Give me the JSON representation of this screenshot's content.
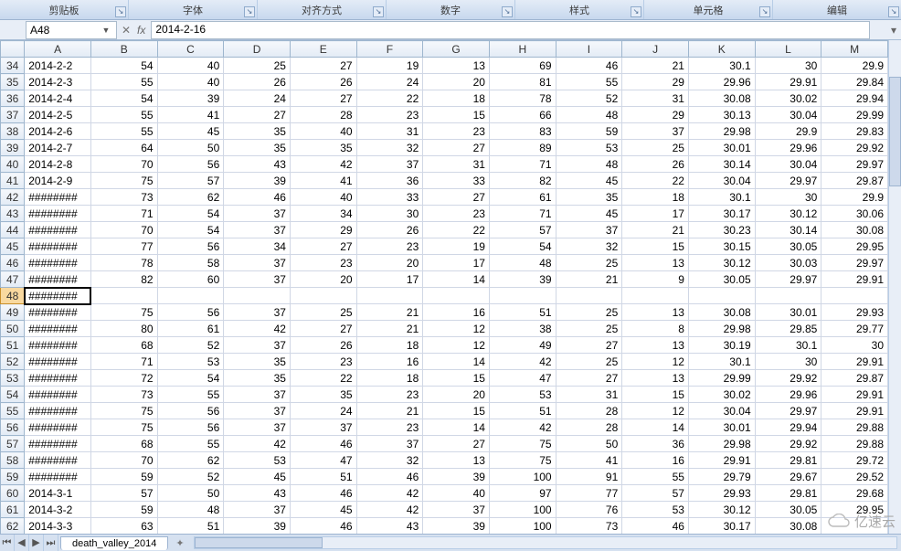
{
  "ribbon": {
    "groups": [
      "剪贴板",
      "字体",
      "对齐方式",
      "数字",
      "样式",
      "单元格",
      "编辑"
    ]
  },
  "namebox": {
    "value": "A48"
  },
  "formula_bar": {
    "fx": "fx",
    "value": "2014-2-16"
  },
  "columns": [
    "A",
    "B",
    "C",
    "D",
    "E",
    "F",
    "G",
    "H",
    "I",
    "J",
    "K",
    "L",
    "M"
  ],
  "selected": {
    "row": 48,
    "col": "A"
  },
  "rows": [
    {
      "n": 34,
      "c": [
        "2014-2-2",
        "54",
        "40",
        "25",
        "27",
        "19",
        "13",
        "69",
        "46",
        "21",
        "30.1",
        "30",
        "29.9"
      ]
    },
    {
      "n": 35,
      "c": [
        "2014-2-3",
        "55",
        "40",
        "26",
        "26",
        "24",
        "20",
        "81",
        "55",
        "29",
        "29.96",
        "29.91",
        "29.84"
      ]
    },
    {
      "n": 36,
      "c": [
        "2014-2-4",
        "54",
        "39",
        "24",
        "27",
        "22",
        "18",
        "78",
        "52",
        "31",
        "30.08",
        "30.02",
        "29.94"
      ]
    },
    {
      "n": 37,
      "c": [
        "2014-2-5",
        "55",
        "41",
        "27",
        "28",
        "23",
        "15",
        "66",
        "48",
        "29",
        "30.13",
        "30.04",
        "29.99"
      ]
    },
    {
      "n": 38,
      "c": [
        "2014-2-6",
        "55",
        "45",
        "35",
        "40",
        "31",
        "23",
        "83",
        "59",
        "37",
        "29.98",
        "29.9",
        "29.83"
      ]
    },
    {
      "n": 39,
      "c": [
        "2014-2-7",
        "64",
        "50",
        "35",
        "35",
        "32",
        "27",
        "89",
        "53",
        "25",
        "30.01",
        "29.96",
        "29.92"
      ]
    },
    {
      "n": 40,
      "c": [
        "2014-2-8",
        "70",
        "56",
        "43",
        "42",
        "37",
        "31",
        "71",
        "48",
        "26",
        "30.14",
        "30.04",
        "29.97"
      ]
    },
    {
      "n": 41,
      "c": [
        "2014-2-9",
        "75",
        "57",
        "39",
        "41",
        "36",
        "33",
        "82",
        "45",
        "22",
        "30.04",
        "29.97",
        "29.87"
      ]
    },
    {
      "n": 42,
      "c": [
        "########",
        "73",
        "62",
        "46",
        "40",
        "33",
        "27",
        "61",
        "35",
        "18",
        "30.1",
        "30",
        "29.9"
      ]
    },
    {
      "n": 43,
      "c": [
        "########",
        "71",
        "54",
        "37",
        "34",
        "30",
        "23",
        "71",
        "45",
        "17",
        "30.17",
        "30.12",
        "30.06"
      ]
    },
    {
      "n": 44,
      "c": [
        "########",
        "70",
        "54",
        "37",
        "29",
        "26",
        "22",
        "57",
        "37",
        "21",
        "30.23",
        "30.14",
        "30.08"
      ]
    },
    {
      "n": 45,
      "c": [
        "########",
        "77",
        "56",
        "34",
        "27",
        "23",
        "19",
        "54",
        "32",
        "15",
        "30.15",
        "30.05",
        "29.95"
      ]
    },
    {
      "n": 46,
      "c": [
        "########",
        "78",
        "58",
        "37",
        "23",
        "20",
        "17",
        "48",
        "25",
        "13",
        "30.12",
        "30.03",
        "29.97"
      ]
    },
    {
      "n": 47,
      "c": [
        "########",
        "82",
        "60",
        "37",
        "20",
        "17",
        "14",
        "39",
        "21",
        "9",
        "30.05",
        "29.97",
        "29.91"
      ]
    },
    {
      "n": 48,
      "c": [
        "########",
        "",
        "",
        "",
        "",
        "",
        "",
        "",
        "",
        "",
        "",
        "",
        ""
      ]
    },
    {
      "n": 49,
      "c": [
        "########",
        "75",
        "56",
        "37",
        "25",
        "21",
        "16",
        "51",
        "25",
        "13",
        "30.08",
        "30.01",
        "29.93"
      ]
    },
    {
      "n": 50,
      "c": [
        "########",
        "80",
        "61",
        "42",
        "27",
        "21",
        "12",
        "38",
        "25",
        "8",
        "29.98",
        "29.85",
        "29.77"
      ]
    },
    {
      "n": 51,
      "c": [
        "########",
        "68",
        "52",
        "37",
        "26",
        "18",
        "12",
        "49",
        "27",
        "13",
        "30.19",
        "30.1",
        "30"
      ]
    },
    {
      "n": 52,
      "c": [
        "########",
        "71",
        "53",
        "35",
        "23",
        "16",
        "14",
        "42",
        "25",
        "12",
        "30.1",
        "30",
        "29.91"
      ]
    },
    {
      "n": 53,
      "c": [
        "########",
        "72",
        "54",
        "35",
        "22",
        "18",
        "15",
        "47",
        "27",
        "13",
        "29.99",
        "29.92",
        "29.87"
      ]
    },
    {
      "n": 54,
      "c": [
        "########",
        "73",
        "55",
        "37",
        "35",
        "23",
        "20",
        "53",
        "31",
        "15",
        "30.02",
        "29.96",
        "29.91"
      ]
    },
    {
      "n": 55,
      "c": [
        "########",
        "75",
        "56",
        "37",
        "24",
        "21",
        "15",
        "51",
        "28",
        "12",
        "30.04",
        "29.97",
        "29.91"
      ]
    },
    {
      "n": 56,
      "c": [
        "########",
        "75",
        "56",
        "37",
        "37",
        "23",
        "14",
        "42",
        "28",
        "14",
        "30.01",
        "29.94",
        "29.88"
      ]
    },
    {
      "n": 57,
      "c": [
        "########",
        "68",
        "55",
        "42",
        "46",
        "37",
        "27",
        "75",
        "50",
        "36",
        "29.98",
        "29.92",
        "29.88"
      ]
    },
    {
      "n": 58,
      "c": [
        "########",
        "70",
        "62",
        "53",
        "47",
        "32",
        "13",
        "75",
        "41",
        "16",
        "29.91",
        "29.81",
        "29.72"
      ]
    },
    {
      "n": 59,
      "c": [
        "########",
        "59",
        "52",
        "45",
        "51",
        "46",
        "39",
        "100",
        "91",
        "55",
        "29.79",
        "29.67",
        "29.52"
      ]
    },
    {
      "n": 60,
      "c": [
        "2014-3-1",
        "57",
        "50",
        "43",
        "46",
        "42",
        "40",
        "97",
        "77",
        "57",
        "29.93",
        "29.81",
        "29.68"
      ]
    },
    {
      "n": 61,
      "c": [
        "2014-3-2",
        "59",
        "48",
        "37",
        "45",
        "42",
        "37",
        "100",
        "76",
        "53",
        "30.12",
        "30.05",
        "29.95"
      ]
    },
    {
      "n": 62,
      "c": [
        "2014-3-3",
        "63",
        "51",
        "39",
        "46",
        "43",
        "39",
        "100",
        "73",
        "46",
        "30.17",
        "30.08",
        ""
      ]
    }
  ],
  "tabs": {
    "nav": [
      "⏮",
      "◀",
      "▶",
      "⏭"
    ],
    "active": "death_valley_2014"
  },
  "watermark": "亿速云"
}
